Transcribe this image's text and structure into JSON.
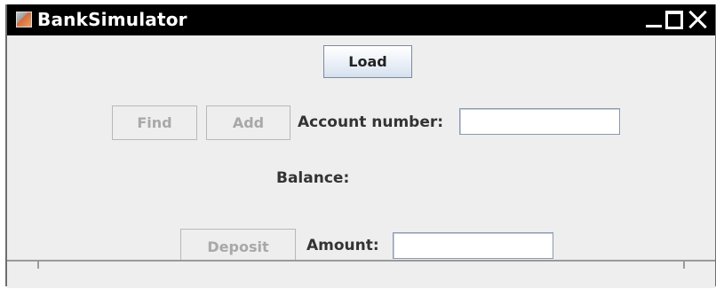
{
  "window": {
    "title": "BankSimulator"
  },
  "buttons": {
    "load": "Load",
    "find": "Find",
    "add": "Add",
    "deposit": "Deposit"
  },
  "labels": {
    "account_number": "Account number:",
    "balance": "Balance:",
    "amount": "Amount:"
  },
  "fields": {
    "account_number_value": "",
    "amount_value": ""
  }
}
